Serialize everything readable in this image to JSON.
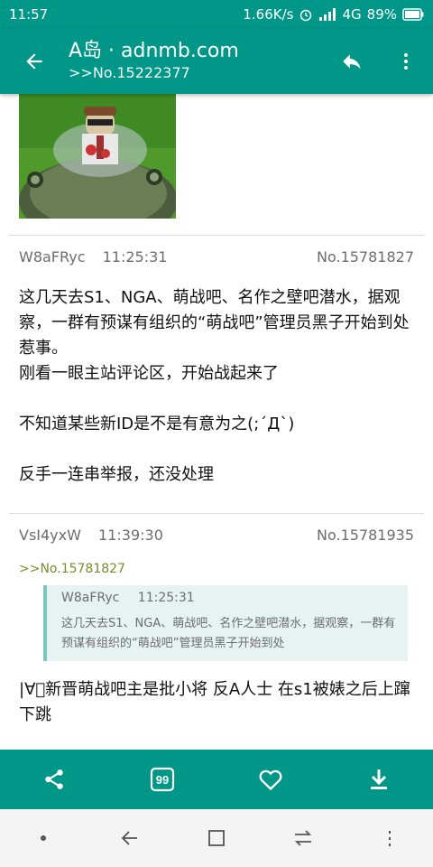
{
  "status_bar": {
    "time": "11:57",
    "speed": "1.66K/s",
    "network": "4G",
    "battery": "89%"
  },
  "app_bar": {
    "title": "A岛 · adnmb.com",
    "subtitle": ">>No.15222377"
  },
  "posts": [
    {
      "uid": "W8aFRyc",
      "time": "11:25:31",
      "no": "No.15781827",
      "body": "这几天去S1、NGA、萌战吧、名作之壁吧潜水，据观察，一群有预谋有组织的“萌战吧”管理员黑子开始到处惹事。\n刚看一眼主站评论区，开始战起来了\n\n不知道某些新ID是不是有意为之(;´Д`)\n\n反手一连串举报，还没处理"
    },
    {
      "uid": "VsI4yxW",
      "time": "11:39:30",
      "no": "No.15781935",
      "ref": ">>No.15781827",
      "quote": {
        "uid": "W8aFRyc",
        "time": "11:25:31",
        "body": "这几天去S1、NGA、萌战吧、名作之壁吧潜水，据观察，一群有预谋有组织的“萌战吧”管理员黑子开始到处"
      },
      "body": "|∀ﾟ新晋萌战吧主是批小将 反A人士 在s1被婊之后上蹿下跳"
    }
  ],
  "bottom_bar": {
    "icons": [
      "share-icon",
      "quote-icon",
      "heart-icon",
      "download-icon"
    ],
    "quote_badge": "99"
  },
  "nav_bar": {
    "icons": [
      "dot-icon",
      "back-icon",
      "recents-icon",
      "switch-icon",
      "menu-icon"
    ]
  },
  "colors": {
    "primary": "#009688",
    "ref_link": "#7a8b2a",
    "quote_bg": "#e6f3f2"
  }
}
